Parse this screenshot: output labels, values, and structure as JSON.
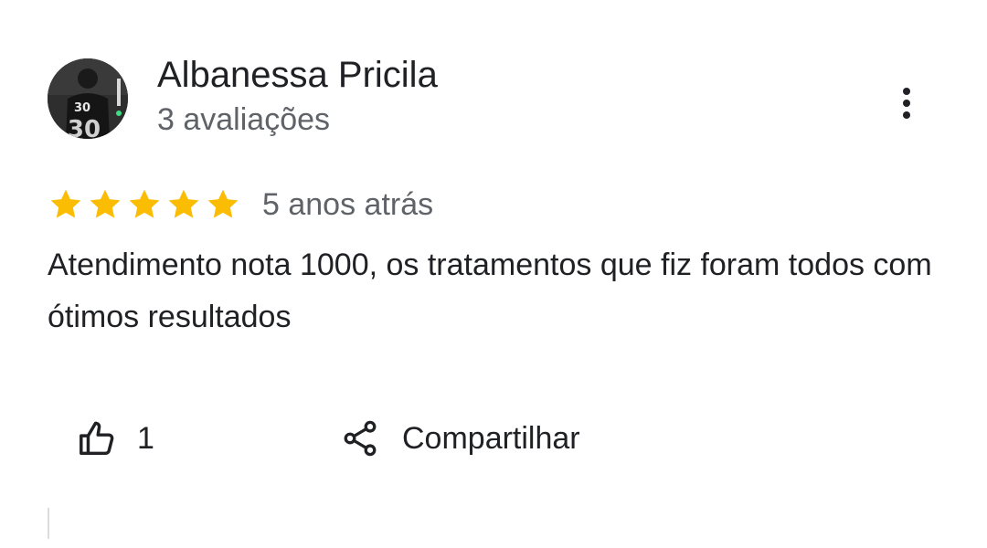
{
  "review": {
    "author_name": "Albanessa Pricila",
    "review_count": "3 avaliações",
    "rating": 5,
    "max_rating": 5,
    "date": "5 anos atrás",
    "text": "Atendimento nota 1000, os tratamentos que fiz foram todos com ótimos resultados",
    "star_color": "#fbbc04"
  },
  "actions": {
    "like_count": "1",
    "share_label": "Compartilhar",
    "like_icon": "thumbs-up-icon",
    "share_icon": "share-icon",
    "more_icon": "more-vertical-icon"
  },
  "avatar": {
    "jersey_number": "30"
  }
}
